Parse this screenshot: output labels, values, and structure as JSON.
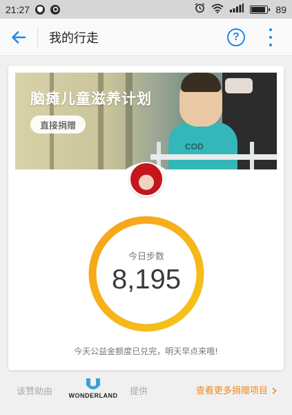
{
  "status_bar": {
    "time": "21:27",
    "battery": "89",
    "battery_fraction": 0.89
  },
  "app_bar": {
    "title": "我的行走",
    "help_label": "?"
  },
  "card": {
    "banner_title": "脑瘫儿童滋养计划",
    "donate_label": "直接捐赠",
    "shirt_text": "COD",
    "steps_label": "今日步数",
    "steps_value": "8,195",
    "note": "今天公益金额度已兑完，明天早点来哦!"
  },
  "footer": {
    "prefix": "该赞助由",
    "brand": "WONDERLAND",
    "suffix": "提供",
    "more_link": "查看更多捐赠项目"
  },
  "colors": {
    "accent_blue": "#1e88e5",
    "ring_start": "#f7a21b",
    "ring_end": "#f5c518",
    "link_orange": "#f08a24",
    "wonderland_blue": "#3aa0d8"
  }
}
